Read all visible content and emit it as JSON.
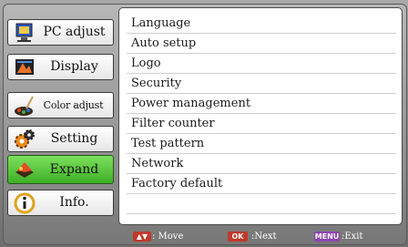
{
  "tabs": [
    {
      "label": "PC adjust",
      "icon": "pc-adjust-icon",
      "active": false
    },
    {
      "label": "Display",
      "icon": "display-icon",
      "active": false
    },
    {
      "label": "Color adjust",
      "icon": "color-adjust-icon",
      "active": false
    },
    {
      "label": "Setting",
      "icon": "setting-icon",
      "active": false
    },
    {
      "label": "Expand",
      "icon": "expand-icon",
      "active": true
    },
    {
      "label": "Info.",
      "icon": "info-icon",
      "active": false
    }
  ],
  "menu_items": [
    "Language",
    "Auto setup",
    "Logo",
    "Security",
    "Power management",
    "Filter counter",
    "Test pattern",
    "Network",
    "Factory default"
  ],
  "footer": {
    "move_key": "▲▼",
    "move_label": ": Move",
    "ok_key": "OK",
    "ok_label": ":Next",
    "menu_key": "MENU",
    "menu_label": ":Exit"
  },
  "colors": {
    "active_tab": "#3fae26",
    "move_key": "#c0392b",
    "ok_key": "#c0392b",
    "menu_key": "#8e44ad"
  }
}
